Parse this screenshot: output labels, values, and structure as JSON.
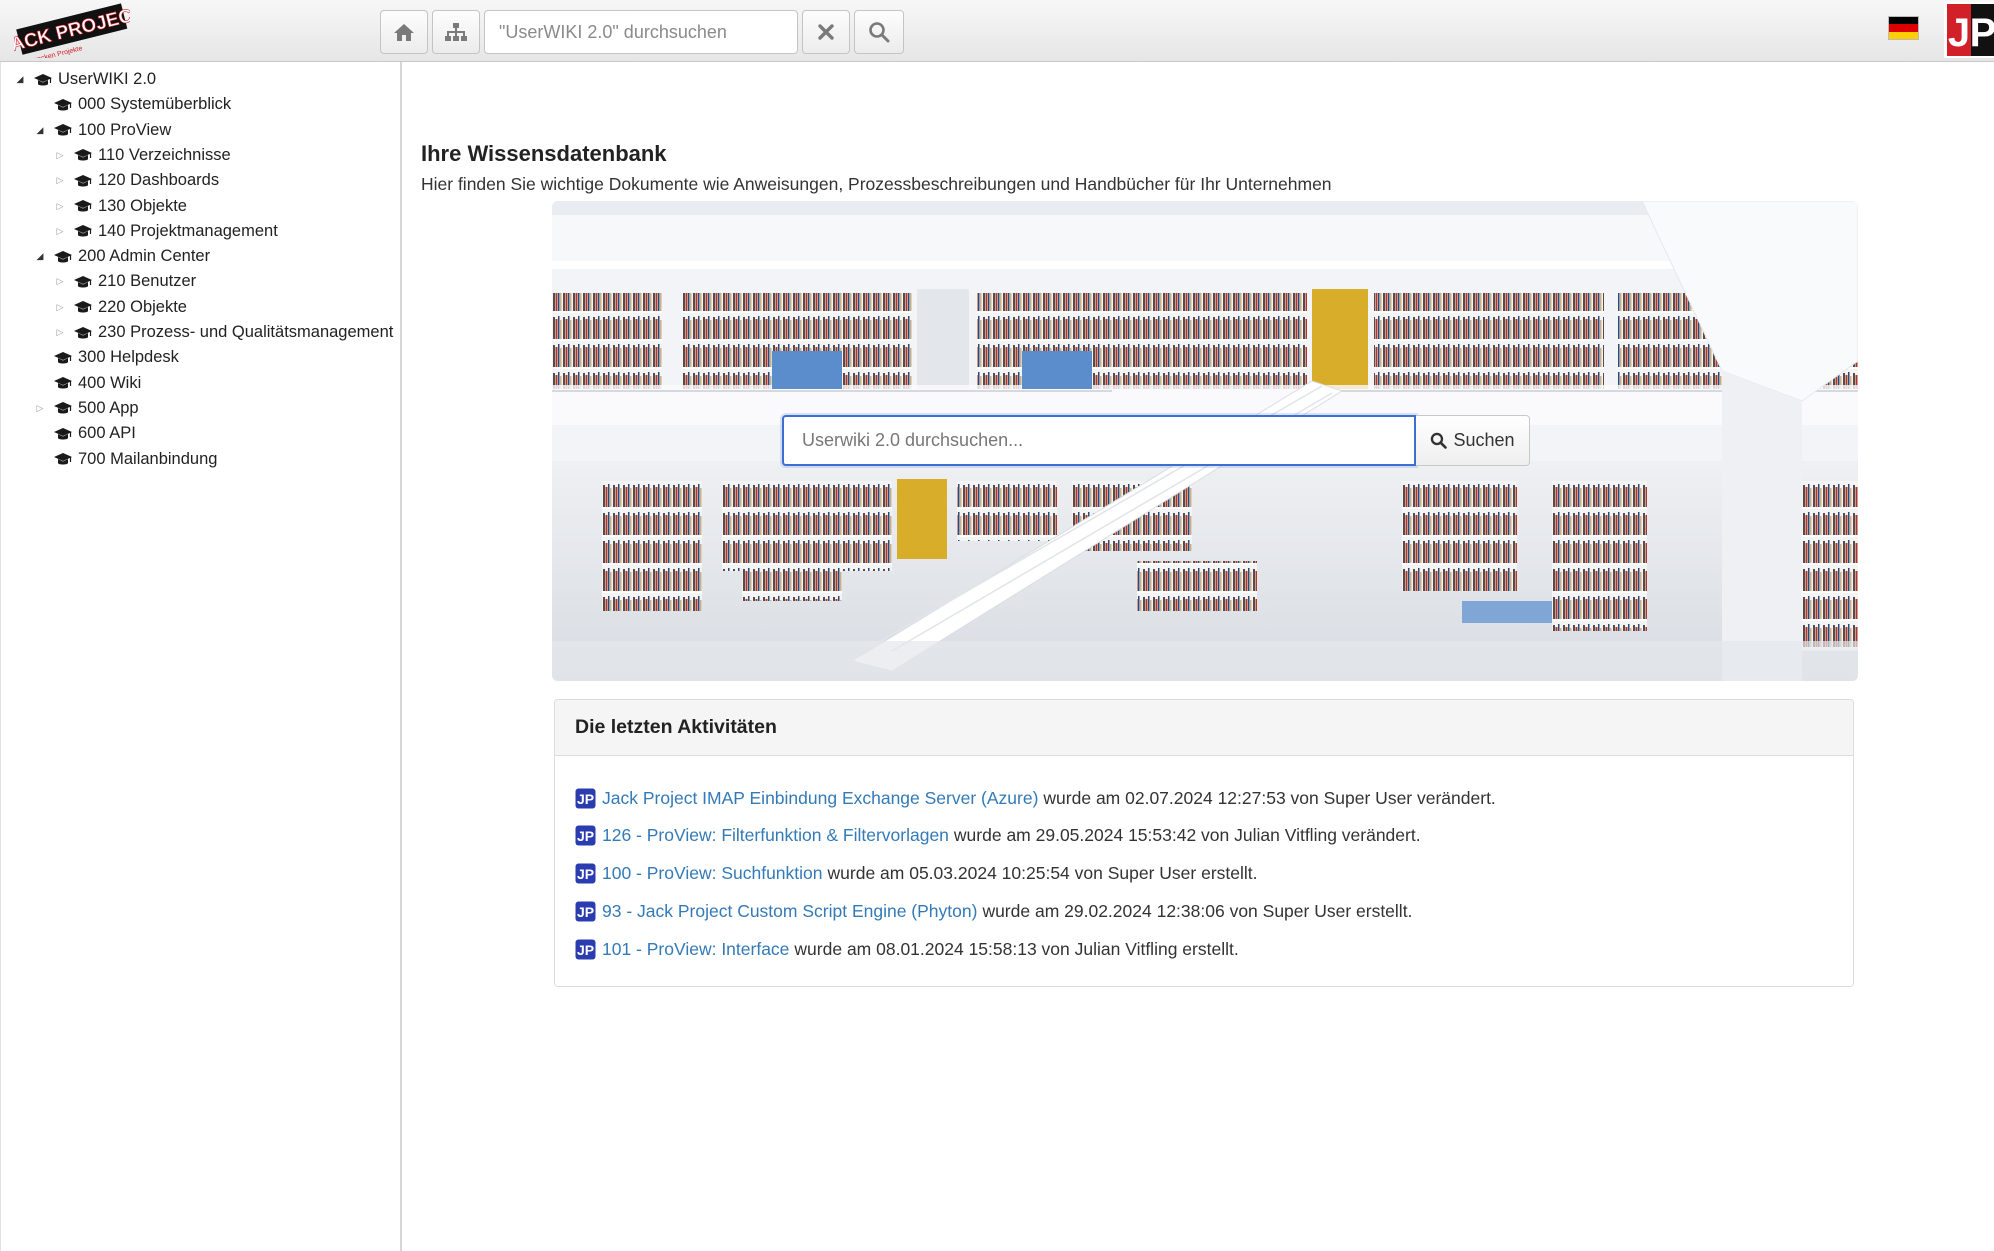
{
  "header": {
    "logo_text": "JACK PROJECT",
    "logo_tagline": "So rocken Projekte",
    "search_placeholder": "\"UserWIKI 2.0\" durchsuchen",
    "language": "de",
    "corner_logo_text": "JP"
  },
  "sidebar": {
    "tree": [
      {
        "label": "UserWIKI 2.0",
        "level": 0,
        "toggle": "expanded"
      },
      {
        "label": "000 Systemüberblick",
        "level": 1,
        "toggle": "none"
      },
      {
        "label": "100 ProView",
        "level": 1,
        "toggle": "expanded"
      },
      {
        "label": "110 Verzeichnisse",
        "level": 2,
        "toggle": "collapsed"
      },
      {
        "label": "120 Dashboards",
        "level": 2,
        "toggle": "collapsed"
      },
      {
        "label": "130 Objekte",
        "level": 2,
        "toggle": "collapsed"
      },
      {
        "label": "140 Projektmanagement",
        "level": 2,
        "toggle": "collapsed"
      },
      {
        "label": "200 Admin Center",
        "level": 1,
        "toggle": "expanded"
      },
      {
        "label": "210 Benutzer",
        "level": 2,
        "toggle": "collapsed"
      },
      {
        "label": "220 Objekte",
        "level": 2,
        "toggle": "collapsed"
      },
      {
        "label": "230 Prozess- und Qualitätsmanagement",
        "level": 2,
        "toggle": "collapsed"
      },
      {
        "label": "300 Helpdesk",
        "level": 1,
        "toggle": "none"
      },
      {
        "label": "400 Wiki",
        "level": 1,
        "toggle": "none"
      },
      {
        "label": "500 App",
        "level": 1,
        "toggle": "collapsed"
      },
      {
        "label": "600 API",
        "level": 1,
        "toggle": "none"
      },
      {
        "label": "700 Mailanbindung",
        "level": 1,
        "toggle": "none"
      }
    ]
  },
  "main": {
    "title": "Ihre Wissensdatenbank",
    "subtitle": "Hier finden Sie wichtige Dokumente wie Anweisungen, Prozessbeschreibungen und Handbücher für Ihr Unternehmen",
    "hero_search": {
      "placeholder": "Userwiki 2.0 durchsuchen...",
      "button_label": "Suchen"
    },
    "activities": {
      "heading": "Die letzten Aktivitäten",
      "items": [
        {
          "link": "Jack Project IMAP Einbindung Exchange Server (Azure)",
          "text": "wurde am 02.07.2024 12:27:53 von Super User verändert."
        },
        {
          "link": "126 - ProView: Filterfunktion & Filtervorlagen",
          "text": "wurde am 29.05.2024 15:53:42 von Julian Vitfling verändert."
        },
        {
          "link": "100 - ProView: Suchfunktion",
          "text": "wurde am 05.03.2024 10:25:54 von Super User erstellt."
        },
        {
          "link": "93 - Jack Project Custom Script Engine (Phyton)",
          "text": "wurde am 29.02.2024 12:38:06 von Super User erstellt."
        },
        {
          "link": "101 - ProView: Interface",
          "text": "wurde am 08.01.2024 15:58:13 von Julian Vitfling erstellt."
        }
      ]
    }
  },
  "colors": {
    "link": "#337ab7",
    "focus_border": "#3c6fd0",
    "brand_red": "#d2202a",
    "jp_icon": "#2b3bb0"
  },
  "icons": {
    "home": "home-icon",
    "tree": "sitemap-icon",
    "clear": "close-icon",
    "search": "search-icon",
    "tree_node": "graduation-cap-icon",
    "activity": "jp-icon"
  }
}
